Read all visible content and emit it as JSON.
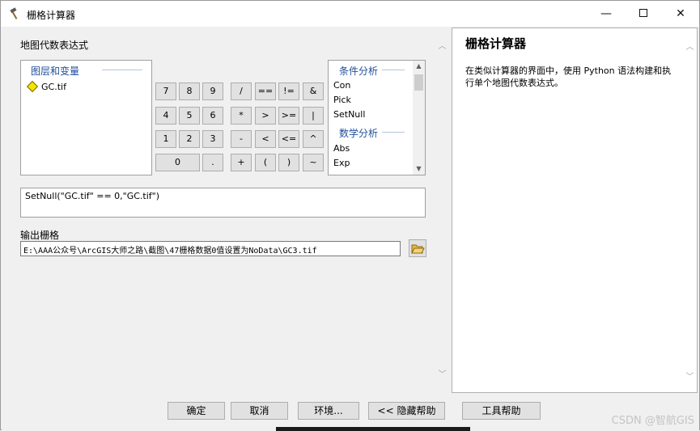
{
  "window": {
    "title": "栅格计算器",
    "close_glyph": "✕",
    "minimize_glyph": "—"
  },
  "expression_section": {
    "label": "地图代数表达式"
  },
  "layers": {
    "header": "图层和变量",
    "items": [
      "GC.tif"
    ]
  },
  "keypad": {
    "row1": [
      "7",
      "8",
      "9",
      "/",
      "==",
      "!=",
      "&"
    ],
    "row2": [
      "4",
      "5",
      "6",
      "*",
      ">",
      ">=",
      "|"
    ],
    "row3": [
      "1",
      "2",
      "3",
      "-",
      "<",
      "<=",
      "^"
    ],
    "row4": [
      "0",
      ".",
      "+",
      "(",
      ")",
      "~"
    ]
  },
  "functions": {
    "conditional_header": "条件分析",
    "conditional_items": [
      "Con",
      "Pick",
      "SetNull"
    ],
    "math_header": "数学分析",
    "math_items": [
      "Abs",
      "Exp"
    ],
    "scroll_up": "▲",
    "scroll_down": "▼"
  },
  "expression": {
    "value": "SetNull(\"GC.tif\" == 0,\"GC.tif\")"
  },
  "output": {
    "label": "输出栅格",
    "value": "E:\\AAA公众号\\ArcGIS大师之路\\截图\\47栅格数据0值设置为NoData\\GC3.tif"
  },
  "help": {
    "title": "栅格计算器",
    "text": "在类似计算器的界面中，使用 Python 语法构建和执行单个地图代数表达式。"
  },
  "buttons": {
    "ok": "确定",
    "cancel": "取消",
    "environments": "环境...",
    "hide_help": "<< 隐藏帮助",
    "tool_help": "工具帮助"
  },
  "watermark": "CSDN @智航GIS",
  "icons": {
    "title": "hammer-icon",
    "folder": "folder-open-icon",
    "diamond": "raster-layer-icon"
  }
}
